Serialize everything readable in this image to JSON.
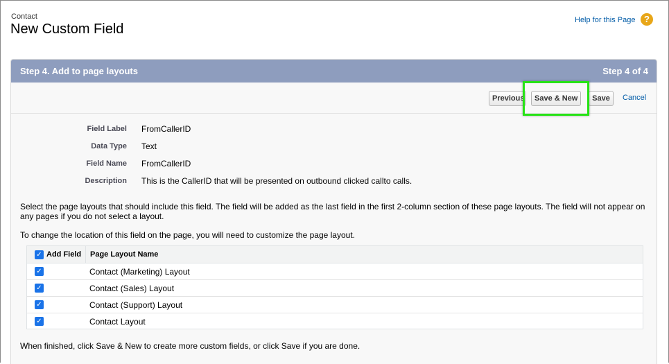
{
  "header": {
    "object_name": "Contact",
    "page_title": "New Custom Field",
    "help_link": "Help for this Page",
    "help_icon": "question-icon"
  },
  "panel": {
    "step_title": "Step 4. Add to page layouts",
    "step_count": "Step 4 of 4",
    "buttons": {
      "previous": "Previous",
      "save_new": "Save & New",
      "save": "Save",
      "cancel": "Cancel"
    },
    "highlight_color": "#27e316"
  },
  "field_info": [
    {
      "label": "Field Label",
      "value": "FromCallerID"
    },
    {
      "label": "Data Type",
      "value": "Text"
    },
    {
      "label": "Field Name",
      "value": "FromCallerID"
    },
    {
      "label": "Description",
      "value": "This is the CallerID that will be presented on outbound clicked callto calls."
    }
  ],
  "instructions": {
    "select_text": "Select the page layouts that should include this field. The field will be added as the last field in the first 2-column section of these page layouts. The field will not appear on any pages if you do not select a layout.",
    "change_text": "To change the location of this field on the page, you will need to customize the page layout.",
    "finished_text": "When finished, click Save & New to create more custom fields, or click Save if you are done."
  },
  "layout_table": {
    "headers": {
      "add_field": "Add Field",
      "layout_name": "Page Layout Name"
    },
    "rows": [
      {
        "checked": true,
        "name": "Contact (Marketing) Layout"
      },
      {
        "checked": true,
        "name": "Contact (Sales) Layout"
      },
      {
        "checked": true,
        "name": "Contact (Support) Layout"
      },
      {
        "checked": true,
        "name": "Contact Layout"
      }
    ]
  }
}
